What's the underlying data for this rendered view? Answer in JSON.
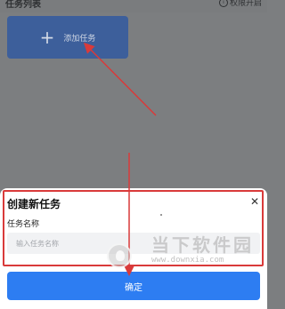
{
  "header": {
    "title": "任务列表",
    "right_label": "权限开启",
    "right_icon": "info-icon"
  },
  "add_card": {
    "icon": "plus-icon",
    "label": "添加任务"
  },
  "dialog": {
    "title": "创建新任务",
    "close_icon": "close-icon",
    "field_label": "任务名称",
    "field_placeholder": "输入任务名称",
    "field_value": "",
    "confirm_label": "确定"
  },
  "watermark": {
    "logo_icon": "watermark-logo-icon",
    "text": "当下软件园",
    "url": "www.downxia.com"
  },
  "colors": {
    "overlay": "#7c7e80",
    "add_card": "#3d5f9b",
    "primary": "#2d7df2",
    "annotation": "#d93a3a",
    "input_bg": "#f1f2f4"
  }
}
